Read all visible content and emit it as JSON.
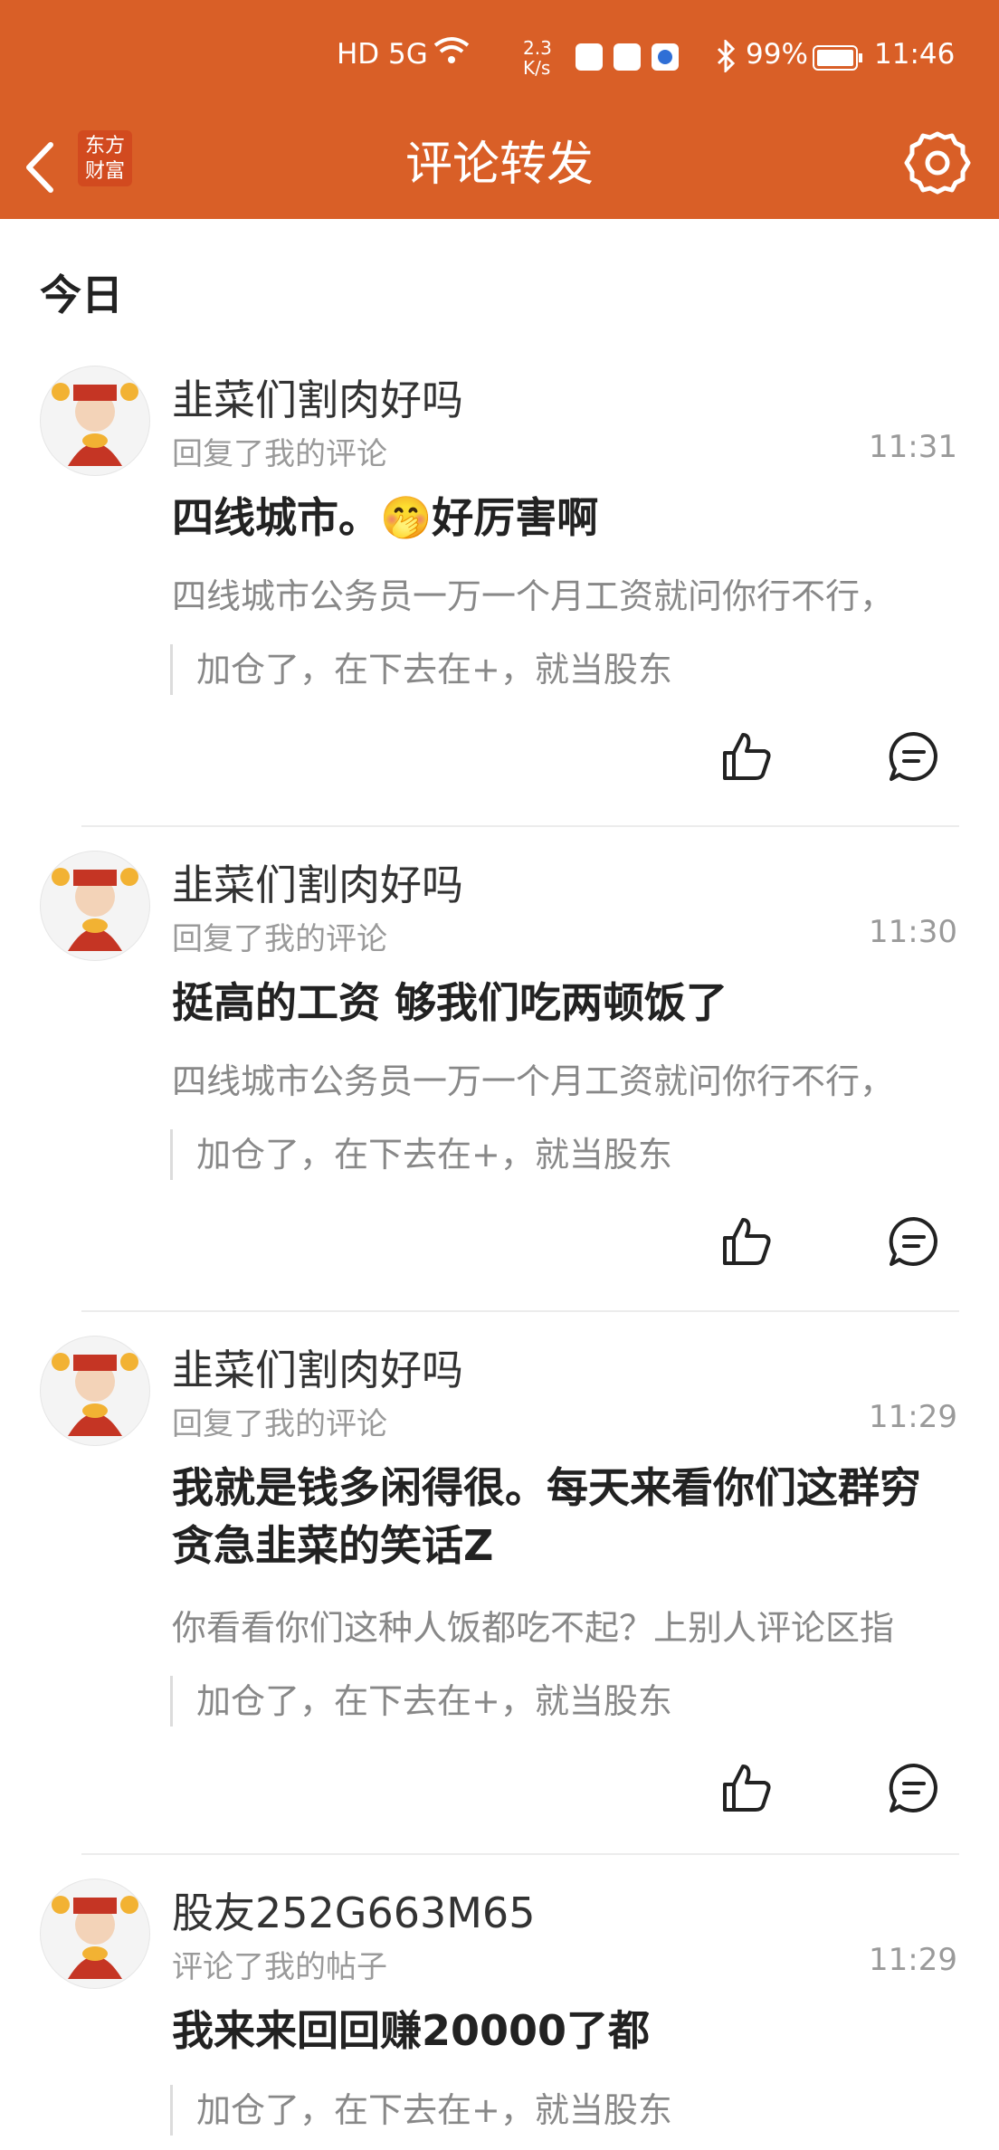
{
  "status_bar": {
    "network": "HD 5G",
    "speed": "2.3 K/s",
    "battery": "99%",
    "time": "11:46"
  },
  "header": {
    "back_icon": "chevron-left-icon",
    "logo_line1": "东方",
    "logo_line2": "财富",
    "title": "评论转发",
    "settings_icon": "gear-icon",
    "accent_color": "#d95f27"
  },
  "section": {
    "title": "今日"
  },
  "items": [
    {
      "username": "韭菜们割肉好吗",
      "action": "回复了我的评论",
      "time": "11:31",
      "reply": "四线城市。🤭好厉害啊",
      "quote": "四线城市公务员一万一个月工资就问你行不行，",
      "original": "加仓了，在下去在+，就当股东"
    },
    {
      "username": "韭菜们割肉好吗",
      "action": "回复了我的评论",
      "time": "11:30",
      "reply": "挺高的工资 够我们吃两顿饭了",
      "quote": "四线城市公务员一万一个月工资就问你行不行，",
      "original": "加仓了，在下去在+，就当股东"
    },
    {
      "username": "韭菜们割肉好吗",
      "action": "回复了我的评论",
      "time": "11:29",
      "reply": "我就是钱多闲得很。每天来看你们这群穷贪急韭菜的笑话Z",
      "quote": "你看看你们这种人饭都吃不起？上别人评论区指",
      "original": "加仓了，在下去在+，就当股东"
    },
    {
      "username": "股友252G663M65",
      "action": "评论了我的帖子",
      "time": "11:29",
      "reply": "我来来回回赚20000了都",
      "quote": "",
      "original": "加仓了，在下去在+，就当股东"
    }
  ]
}
